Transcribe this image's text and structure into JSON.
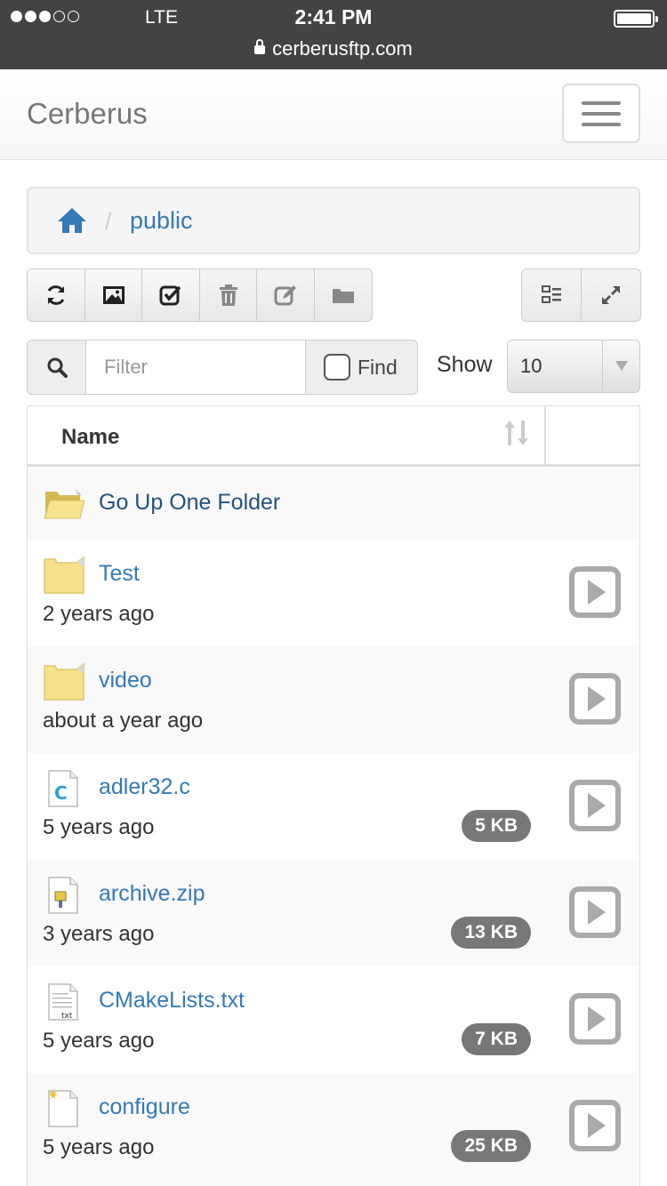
{
  "status_bar": {
    "carrier": "LTE",
    "time": "2:41 PM",
    "url": "cerberusftp.com",
    "signal_bars_filled": 3,
    "signal_bars_total": 5
  },
  "navbar": {
    "brand": "Cerberus",
    "menu_icon": "hamburger-menu-icon"
  },
  "breadcrumb": {
    "home_icon": "home-icon",
    "separator": "/",
    "current": "public"
  },
  "toolbar": {
    "left_buttons": [
      {
        "name": "refresh-button",
        "icon": "refresh-icon"
      },
      {
        "name": "thumbnails-button",
        "icon": "picture-icon"
      },
      {
        "name": "select-button",
        "icon": "checkbox-check-icon"
      },
      {
        "name": "delete-button",
        "icon": "trash-icon"
      },
      {
        "name": "rename-button",
        "icon": "edit-icon"
      },
      {
        "name": "new-folder-button",
        "icon": "folder-icon"
      }
    ],
    "right_buttons": [
      {
        "name": "tree-view-button",
        "icon": "tree-view-icon"
      },
      {
        "name": "fullscreen-button",
        "icon": "expand-icon"
      }
    ]
  },
  "filter": {
    "search_icon": "search-icon",
    "placeholder": "Filter",
    "find_label": "Find",
    "show_label": "Show",
    "show_value": "10"
  },
  "table": {
    "header_name": "Name",
    "up_folder_label": "Go Up One Folder",
    "rows": [
      {
        "name": "Test",
        "modified": "2 years ago",
        "size": "",
        "icon": "folder-icon"
      },
      {
        "name": "video",
        "modified": "about a year ago",
        "size": "",
        "icon": "folder-icon"
      },
      {
        "name": "adler32.c",
        "modified": "5 years ago",
        "size": "5 KB",
        "icon": "c-file-icon"
      },
      {
        "name": "archive.zip",
        "modified": "3 years ago",
        "size": "13 KB",
        "icon": "zip-file-icon"
      },
      {
        "name": "CMakeLists.txt",
        "modified": "5 years ago",
        "size": "7 KB",
        "icon": "txt-file-icon"
      },
      {
        "name": "configure",
        "modified": "5 years ago",
        "size": "25 KB",
        "icon": "executable-file-icon"
      }
    ]
  },
  "colors": {
    "link": "#337ab7",
    "badge": "#777777",
    "status_bar": "#434343",
    "folder": "#f6e08c"
  }
}
